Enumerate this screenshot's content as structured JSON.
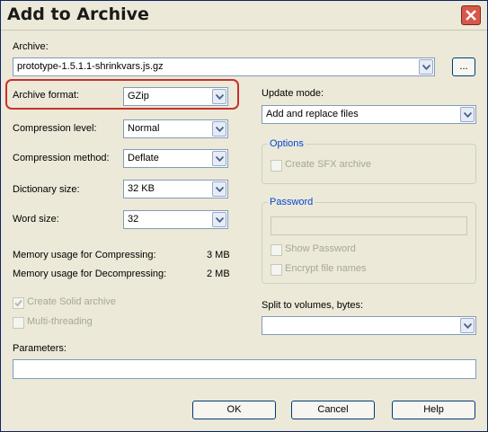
{
  "window": {
    "title": "Add to Archive"
  },
  "archive": {
    "label": "Archive:",
    "path": "prototype-1.5.1.1-shrinkvars.js.gz",
    "browse_label": "..."
  },
  "left": {
    "format": {
      "label": "Archive format:",
      "value": "GZip"
    },
    "level": {
      "label": "Compression level:",
      "value": "Normal"
    },
    "method": {
      "label": "Compression method:",
      "value": "Deflate"
    },
    "dictionary": {
      "label": "Dictionary size:",
      "value": "32 KB"
    },
    "word": {
      "label": "Word size:",
      "value": "32"
    },
    "mem_compress": {
      "label": "Memory usage for Compressing:",
      "value": "3 MB"
    },
    "mem_decompress": {
      "label": "Memory usage for Decompressing:",
      "value": "2 MB"
    },
    "solid_label": "Create Solid archive",
    "solid_checked": true,
    "multithread_label": "Multi-threading",
    "multithread_checked": false,
    "parameters_label": "Parameters:",
    "parameters_value": ""
  },
  "right": {
    "update": {
      "label": "Update mode:",
      "value": "Add and replace files"
    },
    "options": {
      "title": "Options",
      "sfx_label": "Create SFX archive"
    },
    "password": {
      "title": "Password",
      "value": "",
      "show_label": "Show Password",
      "encrypt_label": "Encrypt file names"
    },
    "split": {
      "label": "Split to volumes, bytes:",
      "value": ""
    }
  },
  "buttons": {
    "ok": "OK",
    "cancel": "Cancel",
    "help": "Help"
  },
  "colors": {
    "highlight": "#c8312c",
    "group_title": "#0046d5",
    "close": "#d9574a"
  }
}
